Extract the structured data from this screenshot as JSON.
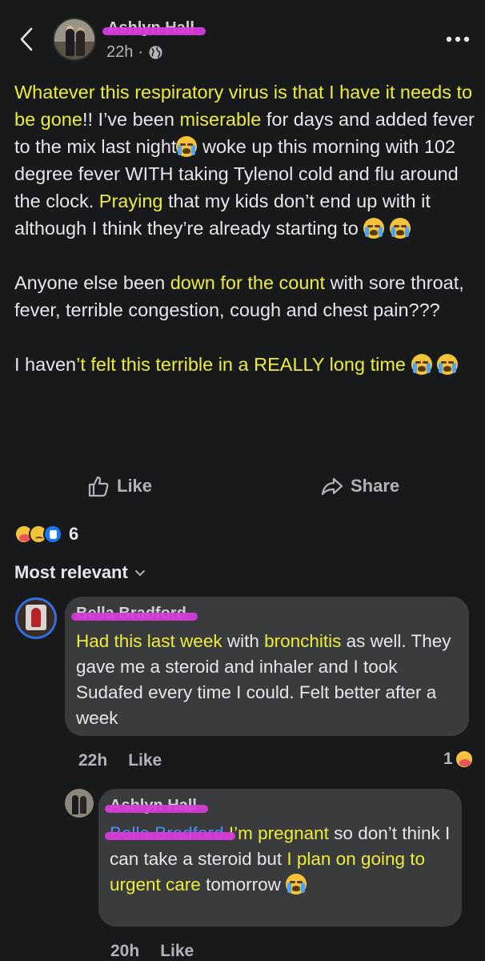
{
  "header": {
    "author_name": "Ashlyn Hall",
    "time": "22h",
    "separator": "·"
  },
  "post": {
    "p1": [
      {
        "t": "Whatever this respiratory virus is that I have it needs to be gone",
        "hl": true
      },
      {
        "t": "!! I’ve been ",
        "hl": false
      },
      {
        "t": "miserable",
        "hl": true
      },
      {
        "t": " for days and added fever to the mix last night",
        "hl": false
      },
      {
        "emoji": "sob"
      },
      {
        "t": " woke up this morning with 102 degree fever WITH taking Tylenol cold and flu around the clock. ",
        "hl": false
      },
      {
        "t": "Praying",
        "hl": true
      },
      {
        "t": " that my kids don’t end up with it although I think they’re already starting to ",
        "hl": false
      },
      {
        "emoji": "sob"
      },
      {
        "t": " ",
        "hl": false
      },
      {
        "emoji": "sob"
      }
    ],
    "p2": [
      {
        "t": "Anyone else been ",
        "hl": false
      },
      {
        "t": "down for the count",
        "hl": true
      },
      {
        "t": " with sore throat, fever, terrible congestion, cough and chest pain???",
        "hl": false
      }
    ],
    "p3": [
      {
        "t": "I haven",
        "hl": false
      },
      {
        "t": "’t felt this terrible in a REALLY long time ",
        "hl": true
      },
      {
        "emoji": "sob"
      },
      {
        "t": " ",
        "hl": false
      },
      {
        "emoji": "sob"
      }
    ]
  },
  "actions": {
    "like_label": "Like",
    "share_label": "Share"
  },
  "reactions": {
    "count": "6"
  },
  "sort": {
    "label": "Most relevant"
  },
  "comments": [
    {
      "author": "Bella Bradford",
      "segments": [
        {
          "t": "Had this last week",
          "hl": true
        },
        {
          "t": " with ",
          "hl": false
        },
        {
          "t": "bronchitis",
          "hl": true
        },
        {
          "t": " as well. They gave me a steroid and inhaler and I took Sudafed every time I could. Felt better after a week",
          "hl": false
        }
      ],
      "time": "22h",
      "like_label": "Like",
      "reaction_count": "1"
    },
    {
      "author": "Ashlyn Hall",
      "mention": "Bella Bradford",
      "segments": [
        {
          "t": " I’m pregnant",
          "hl": true
        },
        {
          "t": " so don’t think I can take a steroid but ",
          "hl": false
        },
        {
          "t": "I plan on going to urgent care",
          "hl": true
        },
        {
          "t": " tomorrow ",
          "hl": false
        },
        {
          "emoji": "sob"
        }
      ],
      "time": "20h",
      "like_label": "Like"
    }
  ],
  "colors": {
    "background": "#18191a",
    "bubble": "#3a3b3c",
    "highlight": "#e2d628",
    "redaction": "#d53bd9",
    "mention": "#4b8bf5"
  },
  "icons": [
    "back-chevron-icon",
    "globe-icon",
    "more-icon",
    "like-thumb-icon",
    "share-arrow-icon",
    "chevron-down-icon",
    "sob-emoji",
    "care-reaction-icon",
    "sad-reaction-icon",
    "like-reaction-icon"
  ]
}
